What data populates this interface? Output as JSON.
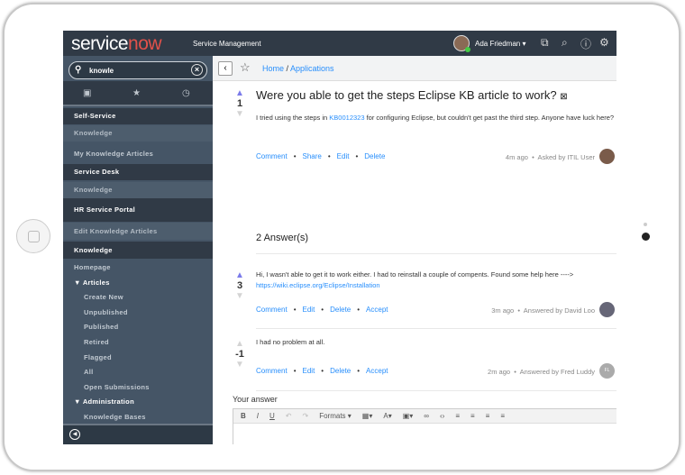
{
  "header": {
    "brand_a": "service",
    "brand_b": "now",
    "product": "Service Management",
    "user": "Ada Friedman"
  },
  "sidebar": {
    "search_value": "knowle",
    "items": [
      {
        "label": "Self-Service",
        "kind": "section"
      },
      {
        "label": "Knowledge",
        "kind": "module"
      },
      {
        "label": "My Knowledge Articles",
        "kind": "link"
      },
      {
        "label": "Service Desk",
        "kind": "section"
      },
      {
        "label": "Knowledge",
        "kind": "module"
      },
      {
        "label": "HR Service Portal",
        "kind": "section"
      },
      {
        "label": "Edit Knowledge Articles",
        "kind": "module"
      },
      {
        "label": "Knowledge",
        "kind": "section"
      },
      {
        "label": "Homepage",
        "kind": "link"
      },
      {
        "label": "▼ Articles",
        "kind": "group"
      },
      {
        "label": "Create New",
        "kind": "sub"
      },
      {
        "label": "Unpublished",
        "kind": "sub"
      },
      {
        "label": "Published",
        "kind": "sub"
      },
      {
        "label": "Retired",
        "kind": "sub"
      },
      {
        "label": "Flagged",
        "kind": "sub"
      },
      {
        "label": "All",
        "kind": "sub"
      },
      {
        "label": "Open Submissions",
        "kind": "sub"
      },
      {
        "label": "▼ Administration",
        "kind": "group"
      },
      {
        "label": "Knowledge Bases",
        "kind": "sub"
      }
    ]
  },
  "breadcrumb": {
    "home": "Home",
    "sep": " / ",
    "current": "Applications"
  },
  "question": {
    "votes": "1",
    "title": "Were you able to get the steps Eclipse KB article to work?",
    "body_a": "I tried using the steps in ",
    "kb_link": "KB0012323",
    "body_b": " for configuring Eclipse, but couldn't get past the third step.   Anyone have luck here?",
    "actions": [
      "Comment",
      "Share",
      "Edit",
      "Delete"
    ],
    "time": "4m ago",
    "author": "Asked by ITIL User"
  },
  "answers_heading": "2 Answer(s)",
  "answers": [
    {
      "votes": "3",
      "body": "Hi,  I wasn't able to get it to work either.  I had to reinstall a couple of compents.  Found some help here ----> ",
      "link": "https://wiki.eclipse.org/Eclipse/Installation",
      "actions": [
        "Comment",
        "Edit",
        "Delete",
        "Accept"
      ],
      "time": "3m ago",
      "author": "Answered by David Loo"
    },
    {
      "votes": "-1",
      "body": "I had no problem at all.",
      "actions": [
        "Comment",
        "Edit",
        "Delete",
        "Accept"
      ],
      "time": "2m ago",
      "author": "Answered by Fred Luddy",
      "initials": "FL"
    }
  ],
  "editor": {
    "label": "Your answer",
    "formats": "Formats ▾"
  }
}
